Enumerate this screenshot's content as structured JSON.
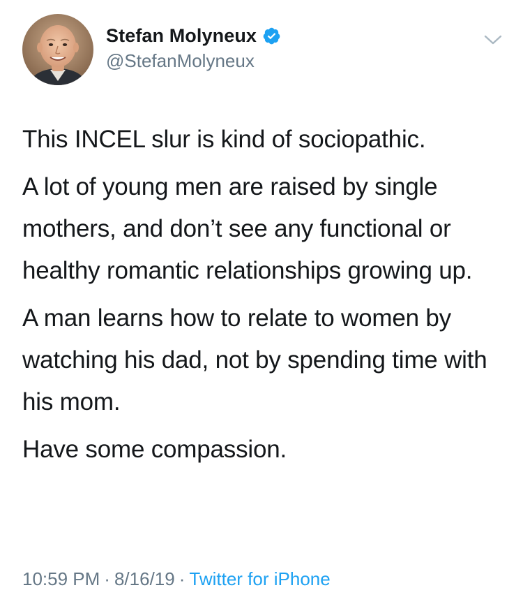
{
  "header": {
    "display_name": "Stefan Molyneux",
    "handle": "@StefanMolyneux",
    "verified": true,
    "avatar_icon": "profile-photo",
    "menu_icon": "chevron-down-icon"
  },
  "tweet": {
    "paragraphs": [
      "This INCEL slur is kind of sociopathic.",
      "A lot of young men are raised by single mothers, and don’t see any functional or healthy romantic relationships growing up.",
      "A man learns how to relate to women by watching his dad, not by spending time with his mom.",
      "Have some compassion."
    ]
  },
  "footer": {
    "time": "10:59 PM",
    "separator": "·",
    "date": "8/16/19",
    "source": "Twitter for iPhone"
  },
  "colors": {
    "text": "#14171a",
    "secondary": "#657786",
    "accent": "#1da1f2",
    "background": "#ffffff"
  }
}
